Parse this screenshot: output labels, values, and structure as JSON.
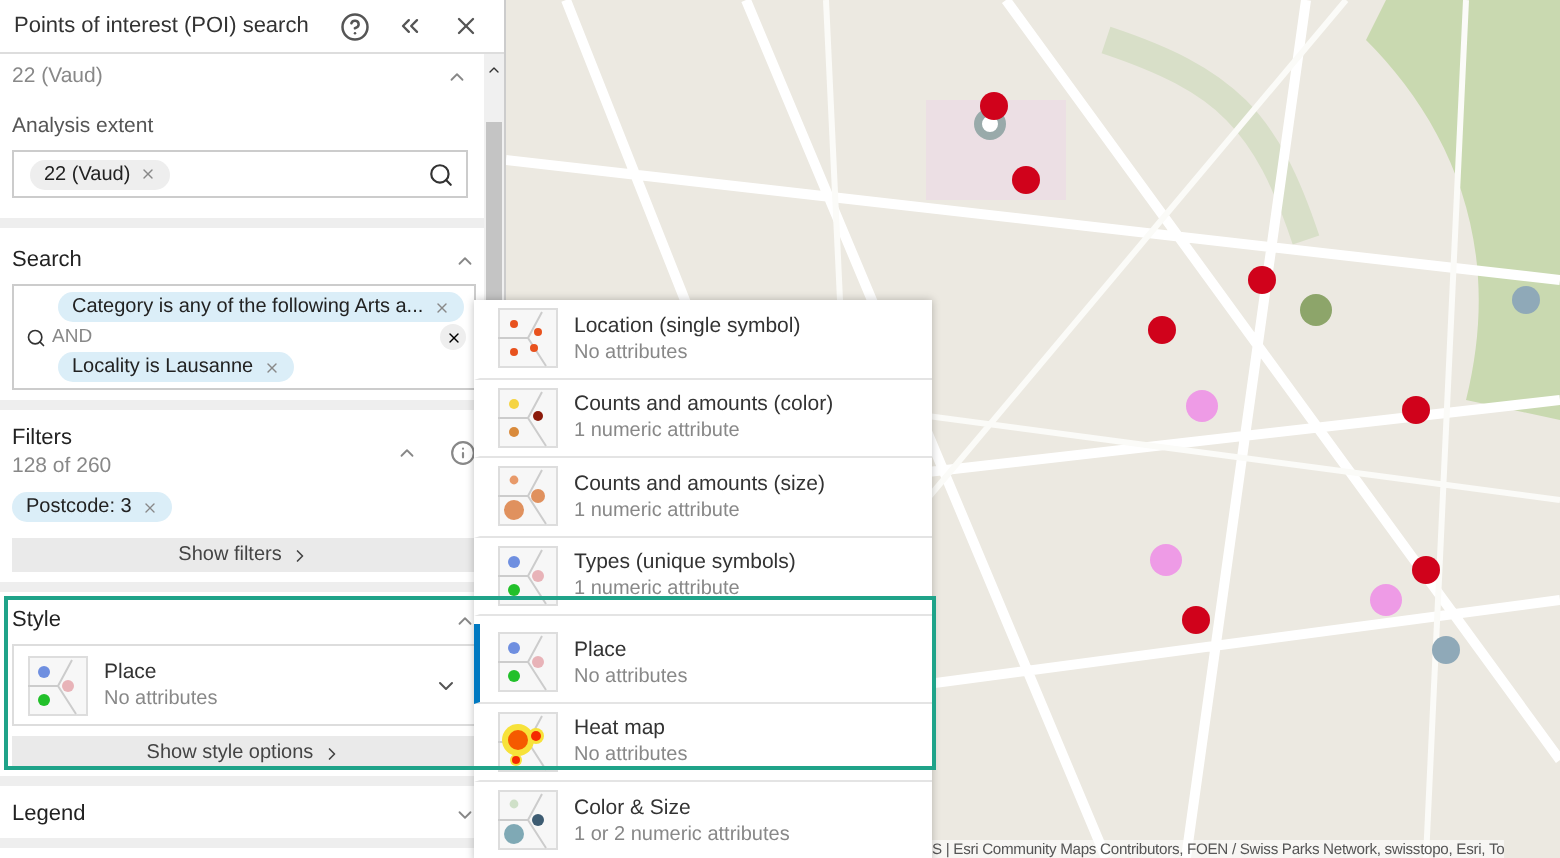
{
  "panel": {
    "title": "Points of interest (POI) search"
  },
  "region": {
    "value": "22 (Vaud)",
    "expanded": true
  },
  "analysis_extent": {
    "label": "Analysis extent",
    "chips": [
      "22 (Vaud)"
    ]
  },
  "search": {
    "title": "Search",
    "expanded": true,
    "chips": [
      "Category is any of the following Arts a...",
      "Locality is Lausanne"
    ],
    "operator": "AND"
  },
  "filters": {
    "title": "Filters",
    "count": "128 of 260",
    "expanded": true,
    "chips": [
      "Postcode: 3"
    ],
    "button": "Show filters"
  },
  "style": {
    "title": "Style",
    "expanded": true,
    "current": {
      "kind": "place",
      "name": "Place",
      "description": "No attributes"
    },
    "menu_open": true,
    "button": "Show style options"
  },
  "legend": {
    "title": "Legend",
    "expanded": false
  },
  "style_menu": [
    {
      "kind": "single",
      "name": "Location (single symbol)",
      "description": "No attributes",
      "selected": false
    },
    {
      "kind": "color",
      "name": "Counts and amounts (color)",
      "description": "1 numeric attribute",
      "selected": false
    },
    {
      "kind": "size",
      "name": "Counts and amounts (size)",
      "description": "1 numeric attribute",
      "selected": false
    },
    {
      "kind": "types",
      "name": "Types (unique symbols)",
      "description": "1 numeric attribute",
      "selected": false
    },
    {
      "kind": "place",
      "name": "Place",
      "description": "No attributes",
      "selected": true
    },
    {
      "kind": "heat",
      "name": "Heat map",
      "description": "No attributes",
      "selected": false
    },
    {
      "kind": "colorsize",
      "name": "Color & Size",
      "description": "1 or 2 numeric attributes",
      "selected": false
    }
  ],
  "map": {
    "kind": "picture",
    "attribution": "S | Esri Community Maps Contributors, FOEN / Swiss Parks Network, swisstopo, Esri, To"
  }
}
